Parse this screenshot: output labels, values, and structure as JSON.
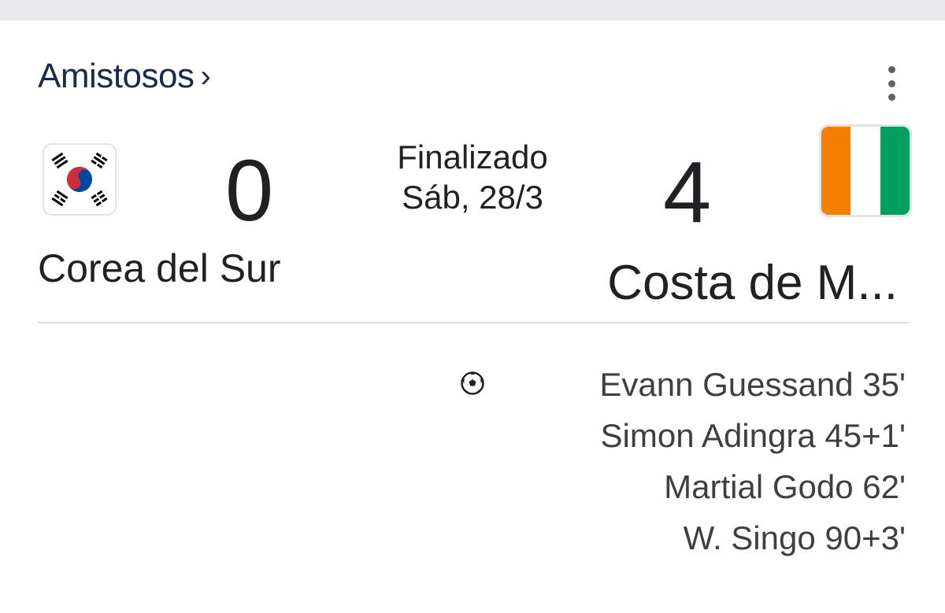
{
  "header": {
    "league": "Amistosos",
    "league_chevron": "›",
    "menu_icon": "more-vert-icon"
  },
  "match": {
    "status": "Finalizado",
    "date": "Sáb, 28/3",
    "home": {
      "name": "Corea del Sur",
      "score": "0",
      "flag": "south-korea-flag"
    },
    "away": {
      "name": "Costa de M...",
      "score": "4",
      "flag": "ivory-coast-flag",
      "flag_colors": [
        "#f77f00",
        "#ffffff",
        "#009e60"
      ]
    }
  },
  "goals": {
    "icon": "soccer-ball-icon",
    "away_scorers": [
      "Evann Guessand 35'",
      "Simon Adingra 45+1'",
      "Martial Godo 62'",
      "W. Singo 90+3'"
    ]
  }
}
